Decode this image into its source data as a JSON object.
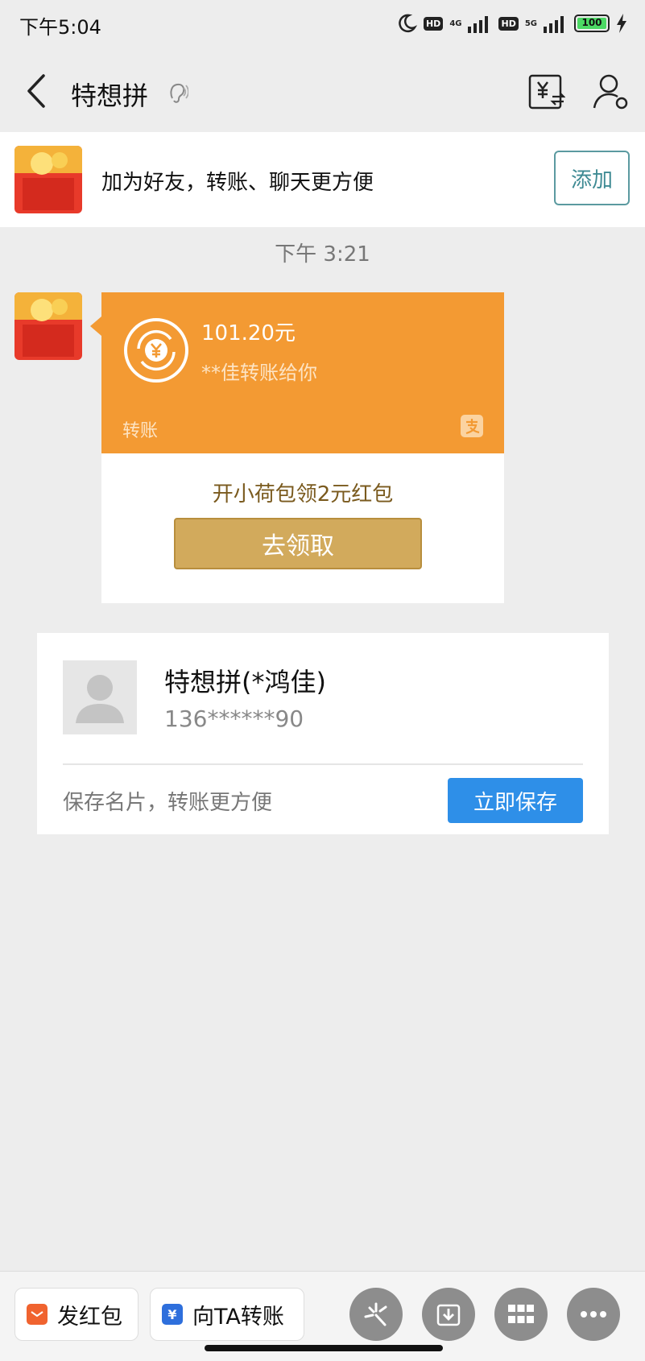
{
  "status_bar": {
    "time": "下午5:04",
    "battery": "100",
    "network_1": "4G",
    "network_2": "5G",
    "hd": "HD"
  },
  "nav": {
    "title": "特想拼"
  },
  "banner": {
    "text": "加为好友，转账、聊天更方便",
    "add_label": "添加"
  },
  "chat": {
    "timestamp": "下午 3:21"
  },
  "transfer": {
    "amount": "101.20元",
    "sender": "**佳转账给你",
    "type_label": "转账",
    "promo": "开小荷包领2元红包",
    "claim_label": "去领取"
  },
  "contact": {
    "name": "特想拼(*鸿佳)",
    "phone": "136******90",
    "hint": "保存名片，转账更方便",
    "save_label": "立即保存"
  },
  "bottom_bar": {
    "red_packet_label": "发红包",
    "transfer_label": "向TA转账",
    "transfer_icon_glyph": "¥"
  },
  "colors": {
    "transfer_orange": "#f39a33",
    "claim_gold": "#d2aa5c",
    "save_blue": "#2e8fe8",
    "add_teal": "#3e8a93"
  }
}
